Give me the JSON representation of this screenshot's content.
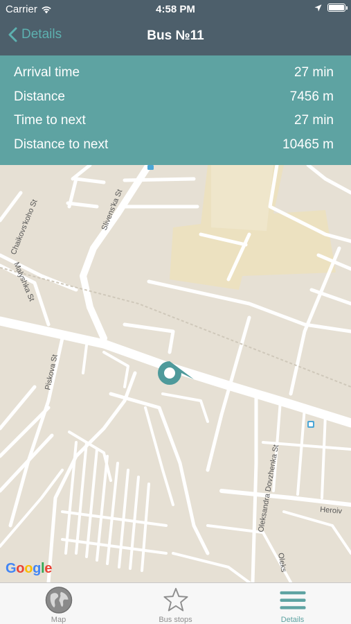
{
  "status_bar": {
    "carrier": "Carrier",
    "time": "4:58 PM"
  },
  "nav": {
    "back_label": "Details",
    "title": "Bus №11"
  },
  "details": [
    {
      "label": "Arrival time",
      "value": "27 min"
    },
    {
      "label": "Distance",
      "value": "7456 m"
    },
    {
      "label": "Time to next",
      "value": "27 min"
    },
    {
      "label": "Distance to next",
      "value": "10465 m"
    }
  ],
  "map": {
    "streets": {
      "chaikovskoho": "Chaikovs'koho St",
      "slivenska": "Slivens'ka St",
      "malyshka": "Malyshka St",
      "piskova": "Piskova St",
      "oleksandra_dovzhenka": "Oleksandra Dovzhenka St",
      "heroiv": "Heroiv",
      "oleks": "Oleks"
    },
    "attribution": "Google",
    "marker_color": "#4e9a9b"
  },
  "tabs": [
    {
      "label": "Map",
      "icon": "globe-icon"
    },
    {
      "label": "Bus stops",
      "icon": "star-icon"
    },
    {
      "label": "Details",
      "icon": "menu-icon"
    }
  ],
  "colors": {
    "nav_bg": "#4d5f6b",
    "accent": "#5ea3a2",
    "map_bg": "#e6e0d4"
  }
}
